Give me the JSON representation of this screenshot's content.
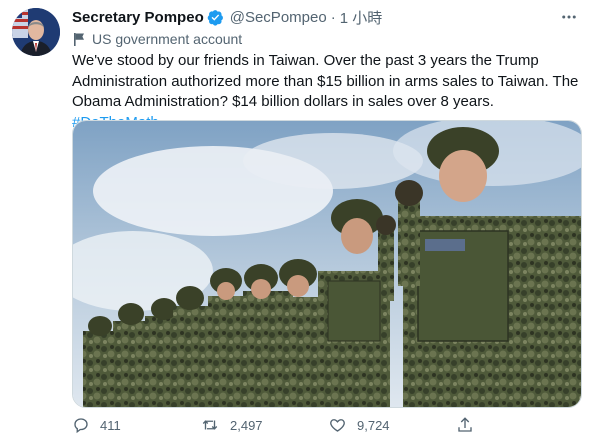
{
  "tweet": {
    "author_name": "Secretary Pompeo",
    "handle": "@SecPompeo",
    "separator": "·",
    "time": "1 小時",
    "account_label": "US government account",
    "text_main": "We've stood by our friends in Taiwan. Over the past 3 years the Trump Administration authorized more than $15 billion in arms sales to Taiwan. The Obama Administration? $14 billion dollars in sales over 8 years. ",
    "hashtag": "#DoTheMath",
    "replies": "411",
    "retweets": "2,497",
    "likes": "9,724"
  },
  "colors": {
    "text": "#0f1419",
    "secondary": "#536471",
    "accent": "#1d9bf0",
    "border": "#cfd9de"
  },
  "icons": [
    "verified-badge-icon",
    "more-icon",
    "flag-icon",
    "reply-icon",
    "retweet-icon",
    "like-icon",
    "share-icon"
  ]
}
